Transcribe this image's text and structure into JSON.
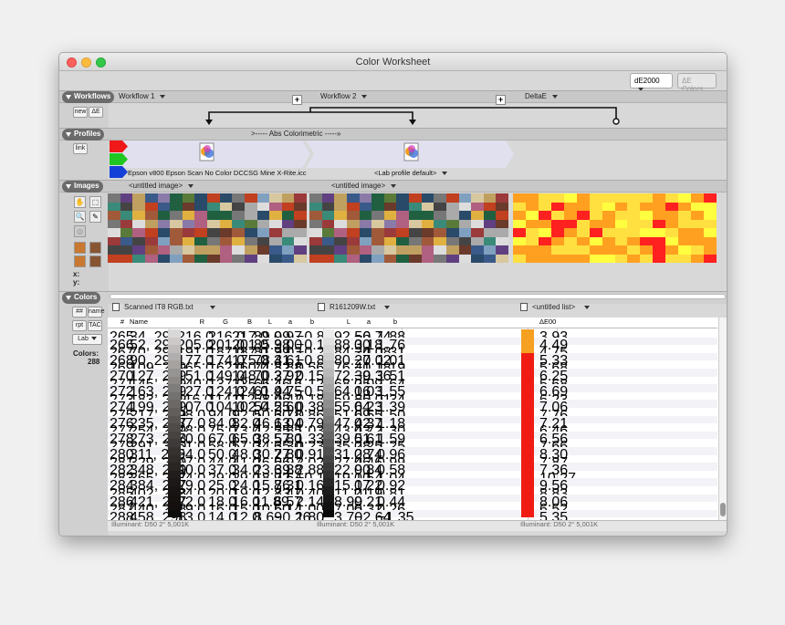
{
  "window": {
    "title": "Color Worksheet"
  },
  "toolbar": {
    "metric": "dE2000",
    "colors_btn": "ΔE Colors"
  },
  "workflows": {
    "label": "Workflows",
    "new": "new",
    "de": "ΔE",
    "wf1": "Workflow 1",
    "wf2": "Workflow 2",
    "delta": "DeltaE",
    "plus": "+"
  },
  "profiles": {
    "label": "Profiles",
    "link": "link",
    "abs": ">----- Abs Colorimetric -----»",
    "p1": "Epson v800 Epson Scan No Color DCCSG Mine X-Rite.icc",
    "p2": "<Lab profile default>",
    "colors": [
      "#f01818",
      "#22c622",
      "#1540d8"
    ]
  },
  "images": {
    "label": "Images",
    "img1": "<untitled image>",
    "img2": "<untitled image>",
    "x": "x:",
    "y": "y:"
  },
  "colors": {
    "label": "Colors",
    "hash": "##",
    "name": "name",
    "rpt": "rpt",
    "tac": "TAC",
    "lab": "Lab",
    "count_label": "Colors:",
    "count": "288",
    "list1": "Scanned IT8 RGB.txt",
    "list2": "R161209W.txt",
    "list3": "<untitled list>",
    "h": {
      "num": "#",
      "name": "Name",
      "R": "R",
      "G": "G",
      "B": "B",
      "L": "L",
      "a": "a",
      "b": "b",
      "L2": "L",
      "a2": "a",
      "b2": "b",
      "de": "ΔE00"
    },
    "illuminant": "Illuminant: D50 2° 5,001K",
    "rows": [
      [
        "265",
        "34, 299",
        "216.0",
        "216.0",
        "217.0",
        "89.99",
        "0.97",
        "−0.86",
        "92.56",
        "−0.74",
        "1.88",
        "3.93"
      ],
      [
        "266",
        "52, 299",
        "205.0",
        "201.0",
        "201.0",
        "85.98",
        "3.00",
        "−0.10",
        "88.30",
        "0.18",
        "1.76",
        "4.49"
      ],
      [
        "267",
        "70, 299",
        "191.0",
        "187.0",
        "187.0",
        "81.99",
        "3.03",
        "−0.26",
        "84.24",
        "−0.08",
        "1.31",
        "4.75"
      ],
      [
        "268",
        "90, 299",
        "177.0",
        "174.0",
        "175.0",
        "78.41",
        "3.61",
        "−0.89",
        "80.27",
        "−0.02",
        "1.01",
        "5.33"
      ],
      [
        "269",
        "109, 299",
        "165.0",
        "162.0",
        "160.0",
        "74.82",
        "3.88",
        "0.56",
        "76.41",
        "−0.18",
        "1.19",
        "5.68"
      ],
      [
        "270",
        "127, 299",
        "151.0",
        "149.0",
        "148.0",
        "70.27",
        "3.92",
        "0.15",
        "72.39",
        "−0.36",
        "1.51",
        "6.25"
      ],
      [
        "271",
        "145, 299",
        "140.0",
        "137.0",
        "135.0",
        "66.46",
        "4.16",
        "1.12",
        "68.25",
        "0.09",
        "1.64",
        "5.68"
      ],
      [
        "272",
        "163, 299",
        "127.0",
        "124.0",
        "124.0",
        "61.94",
        "4.75",
        "−0.51",
        "64.16",
        "0.03",
        "1.55",
        "6.69"
      ],
      [
        "273",
        "183, 299",
        "116.0",
        "114.0",
        "112.0",
        "58.06",
        "4.42",
        "0.18",
        "59.85",
        "−0.01",
        "1.34",
        "6.23"
      ],
      [
        "274",
        "199, 299",
        "107.0",
        "104.0",
        "102.0",
        "54.25",
        "5.60",
        "0.38",
        "55.64",
        "0.23",
        "1.39",
        "7.06"
      ],
      [
        "275",
        "217, 299",
        "98.0",
        "94.0",
        "92.0",
        "50.30",
        "6.78",
        "0.86",
        "51.69",
        "0.55",
        "1.50",
        "7.76"
      ],
      [
        "276",
        "235, 297",
        "87.0",
        "84.0",
        "82.0",
        "46.13",
        "6.04",
        "0.79",
        "47.42",
        "0.37",
        "1.18",
        "7.21"
      ],
      [
        "277",
        "254, 299",
        "78.0",
        "75.0",
        "73.0",
        "42.25",
        "5.85",
        "1.03",
        "43.43",
        "0.72",
        "1.30",
        "6.46"
      ],
      [
        "278",
        "273, 298",
        "70.0",
        "67.0",
        "65.0",
        "38.57",
        "5.80",
        "1.33",
        "39.51",
        "0.61",
        "1.59",
        "6.56"
      ],
      [
        "279",
        "291, 300",
        "61.0",
        "58.0",
        "57.0",
        "34.35",
        "6.30",
        "0.23",
        "35.28",
        "0.25",
        "1.25",
        "7.66"
      ],
      [
        "280",
        "311, 299",
        "54.0",
        "50.0",
        "48.0",
        "30.27",
        "7.80",
        "0.91",
        "31.28",
        "0.74",
        "0.96",
        "8.30"
      ],
      [
        "281",
        "329, 299",
        "47.0",
        "44.0",
        "41.0",
        "26.96",
        "6.97",
        "2.02",
        "27.46",
        "0.46",
        "0.99",
        "7.87"
      ],
      [
        "282",
        "348, 299",
        "40.0",
        "37.0",
        "34.0",
        "23.39",
        "6.88",
        "2.88",
        "22.90",
        "0.84",
        "0.58",
        "7.36"
      ],
      [
        "283",
        "365, 297",
        "34.0",
        "29.0",
        "29.0",
        "18.72",
        "9.64",
        "−0.18",
        "19.10",
        "0.54",
        "1.04",
        "10.27"
      ],
      [
        "284",
        "384, 297",
        "29.0",
        "25.0",
        "24.0",
        "15.76",
        "8.31",
        "0.16",
        "15.17",
        "0.22",
        "0.92",
        "9.56"
      ],
      [
        "285",
        "402, 298",
        "24.0",
        "20.0",
        "19.0",
        "12.83",
        "7.47",
        "0.40",
        "11.21",
        "0.19",
        "0.81",
        "8.83"
      ],
      [
        "286",
        "421, 297",
        "22.0",
        "18.0",
        "16.0",
        "11.89",
        "6.57",
        "2.14",
        "8.99",
        "0.21",
        "0.44",
        "8.06"
      ],
      [
        "287",
        "440, 298",
        "19.0",
        "16.0",
        "15.0",
        "10.60",
        "5.14",
        "1.00",
        "7.05",
        "0.32",
        "0.26",
        "6.52"
      ],
      [
        "288",
        "458, 298",
        "13.0",
        "14.0",
        "12.0",
        "8.69",
        "−0.26",
        "1.80",
        "3.70",
        "−2.64",
        "−1.35",
        "5.35"
      ]
    ],
    "de_colors": [
      "#f5a020",
      "#f5a020",
      "#f5a020",
      "#f01c14",
      "#f01c14",
      "#f01c14",
      "#f01c14",
      "#f01c14",
      "#f01c14",
      "#f01c14",
      "#f01c14",
      "#f01c14",
      "#f01c14",
      "#f01c14",
      "#f01c14",
      "#f01c14",
      "#f01c14",
      "#f01c14",
      "#f01c14",
      "#f01c14",
      "#f01c14",
      "#f01c14",
      "#f01c14",
      "#f01c14"
    ]
  }
}
